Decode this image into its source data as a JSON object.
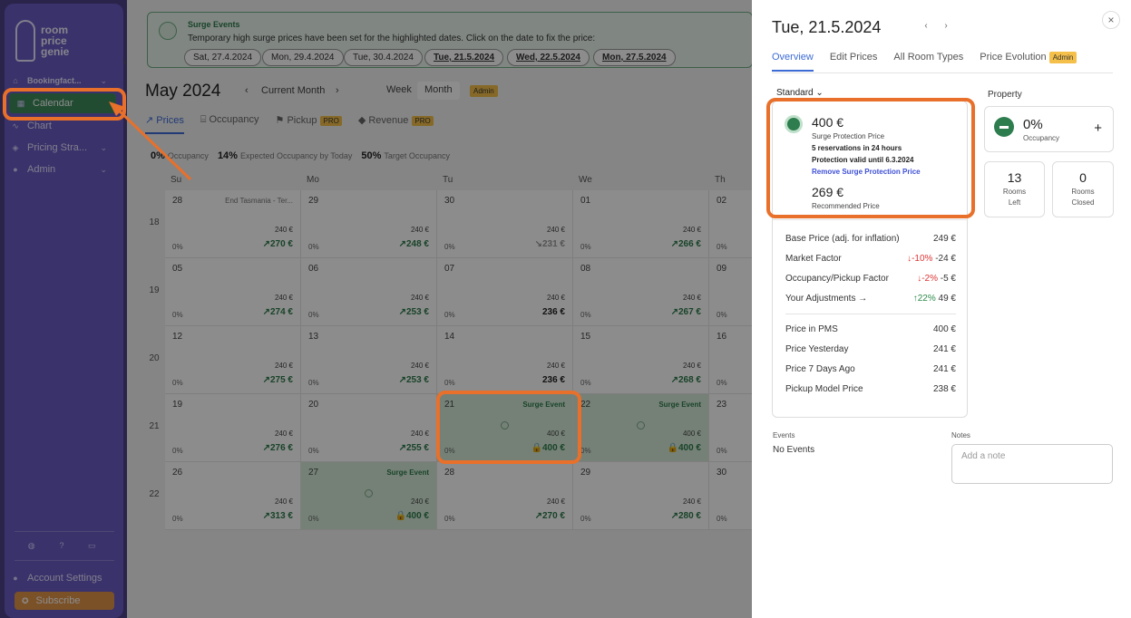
{
  "sidebar": {
    "logo": [
      "room",
      "price",
      "genie"
    ],
    "items": [
      {
        "label": "Bookingfact...",
        "icon": "home-icon"
      },
      {
        "label": "Calendar",
        "icon": "calendar-icon"
      },
      {
        "label": "Chart",
        "icon": "chart-icon"
      },
      {
        "label": "Pricing Stra...",
        "icon": "strategy-icon"
      },
      {
        "label": "Admin",
        "icon": "user-icon"
      }
    ],
    "account": "Account Settings",
    "subscribe": "Subscribe"
  },
  "banner": {
    "title": "Surge Events",
    "text": "Temporary high surge prices have been set for the highlighted dates. Click on the date to fix the price:",
    "dates": [
      "Sat, 27.4.2024",
      "Mon, 29.4.2024",
      "Tue, 30.4.2024",
      "Tue, 21.5.2024",
      "Wed, 22.5.2024",
      "Mon, 27.5.2024"
    ]
  },
  "toolbar": {
    "month": "May 2024",
    "current": "Current Month",
    "week": "Week",
    "month_btn": "Month",
    "admin": "Admin"
  },
  "tabs": {
    "prices": "Prices",
    "occupancy": "Occupancy",
    "pickup": "Pickup",
    "revenue": "Revenue",
    "pro": "PRO"
  },
  "stats": [
    {
      "value": "0%",
      "label": "Occupancy"
    },
    {
      "value": "14%",
      "label": "Expected Occupancy by Today"
    },
    {
      "value": "50%",
      "label": "Target Occupancy"
    }
  ],
  "calendar": {
    "days": [
      "Su",
      "Mo",
      "Tu",
      "We",
      "Th"
    ],
    "weeks": [
      "18",
      "19",
      "20",
      "21",
      "22"
    ],
    "cells": [
      [
        {
          "d": "28",
          "ev": "End Tasmania - Ter...",
          "p1": "240 €",
          "p2": "↗270 €",
          "o": "0%"
        },
        {
          "d": "29",
          "p1": "240 €",
          "p2": "↗248 €",
          "o": "0%"
        },
        {
          "d": "30",
          "p1": "240 €",
          "p2": "↘231 €",
          "o": "0%"
        },
        {
          "d": "01",
          "p1": "240 €",
          "p2": "↗266 €",
          "o": "0%"
        },
        {
          "d": "02",
          "p1": "",
          "p2": "",
          "o": "0%"
        }
      ],
      [
        {
          "d": "05",
          "p1": "240 €",
          "p2": "↗274 €",
          "o": "0%"
        },
        {
          "d": "06",
          "p1": "240 €",
          "p2": "↗253 €",
          "o": "0%"
        },
        {
          "d": "07",
          "p1": "240 €",
          "p2": "236 €",
          "o": "0%"
        },
        {
          "d": "08",
          "p1": "240 €",
          "p2": "↗267 €",
          "o": "0%"
        },
        {
          "d": "09",
          "p1": "",
          "p2": "",
          "o": "0%"
        }
      ],
      [
        {
          "d": "12",
          "p1": "240 €",
          "p2": "↗275 €",
          "o": "0%"
        },
        {
          "d": "13",
          "p1": "240 €",
          "p2": "↗253 €",
          "o": "0%"
        },
        {
          "d": "14",
          "p1": "240 €",
          "p2": "236 €",
          "o": "0%"
        },
        {
          "d": "15",
          "p1": "240 €",
          "p2": "↗268 €",
          "o": "0%"
        },
        {
          "d": "16",
          "p1": "",
          "p2": "",
          "o": "0%"
        }
      ],
      [
        {
          "d": "19",
          "p1": "240 €",
          "p2": "↗276 €",
          "o": "0%"
        },
        {
          "d": "20",
          "p1": "240 €",
          "p2": "↗255 €",
          "o": "0%"
        },
        {
          "d": "21",
          "ev": "Surge Event",
          "p1": "400 €",
          "p2": "🔒400 €",
          "o": "0%"
        },
        {
          "d": "22",
          "ev": "Surge Event",
          "p1": "400 €",
          "p2": "🔒400 €",
          "o": "0%"
        },
        {
          "d": "23",
          "p1": "",
          "p2": "",
          "o": "0%"
        }
      ],
      [
        {
          "d": "26",
          "p1": "240 €",
          "p2": "↗313 €",
          "o": "0%"
        },
        {
          "d": "27",
          "ev": "Surge Event",
          "p1": "240 €",
          "p2": "🔒400 €",
          "o": "0%"
        },
        {
          "d": "28",
          "p1": "240 €",
          "p2": "↗270 €",
          "o": "0%"
        },
        {
          "d": "29",
          "p1": "240 €",
          "p2": "↗280 €",
          "o": "0%"
        },
        {
          "d": "30",
          "p1": "",
          "p2": "",
          "o": "0%"
        }
      ]
    ]
  },
  "panel": {
    "date": "Tue, 21.5.2024",
    "tabs": [
      "Overview",
      "Edit Prices",
      "All Room Types",
      "Price Evolution"
    ],
    "admin": "Admin",
    "room_type": "Standard",
    "surge_price": "400 €",
    "surge_label": "Surge Protection Price",
    "reservations": "5 reservations in 24 hours",
    "valid": "Protection valid until 6.3.2024",
    "remove": "Remove Surge Protection Price",
    "rec_price": "269 €",
    "rec_label": "Recommended Price",
    "breakdown": [
      {
        "label": "Base Price (adj. for inflation)",
        "pct": "",
        "value": "249 €"
      },
      {
        "label": "Market Factor",
        "pct": "↓-10%",
        "value": "-24 €",
        "dir": "dn"
      },
      {
        "label": "Occupancy/Pickup Factor",
        "pct": "↓-2%",
        "value": "-5 €",
        "dir": "dn"
      },
      {
        "label": "Your Adjustments  →",
        "pct": "↑22%",
        "value": "49 €",
        "dir": "up"
      }
    ],
    "history": [
      {
        "label": "Price in PMS",
        "value": "400 €"
      },
      {
        "label": "Price Yesterday",
        "value": "241 €"
      },
      {
        "label": "Price 7 Days Ago",
        "value": "241 €"
      },
      {
        "label": "Pickup Model Price",
        "value": "238 €"
      }
    ],
    "property": "Property",
    "occupancy": "0%",
    "occupancy_label": "Occupancy",
    "rooms_left": "13",
    "rooms_left_label": "Rooms Left",
    "rooms_closed": "0",
    "rooms_closed_label": "Rooms Closed",
    "events_label": "Events",
    "events_value": "No Events",
    "notes_label": "Notes",
    "notes_placeholder": "Add a note"
  },
  "colors": {
    "highlight": "#e8702a",
    "sidebar": "#6a5cc4",
    "surge": "#d6ecd9",
    "accent": "#3d6bd6"
  }
}
